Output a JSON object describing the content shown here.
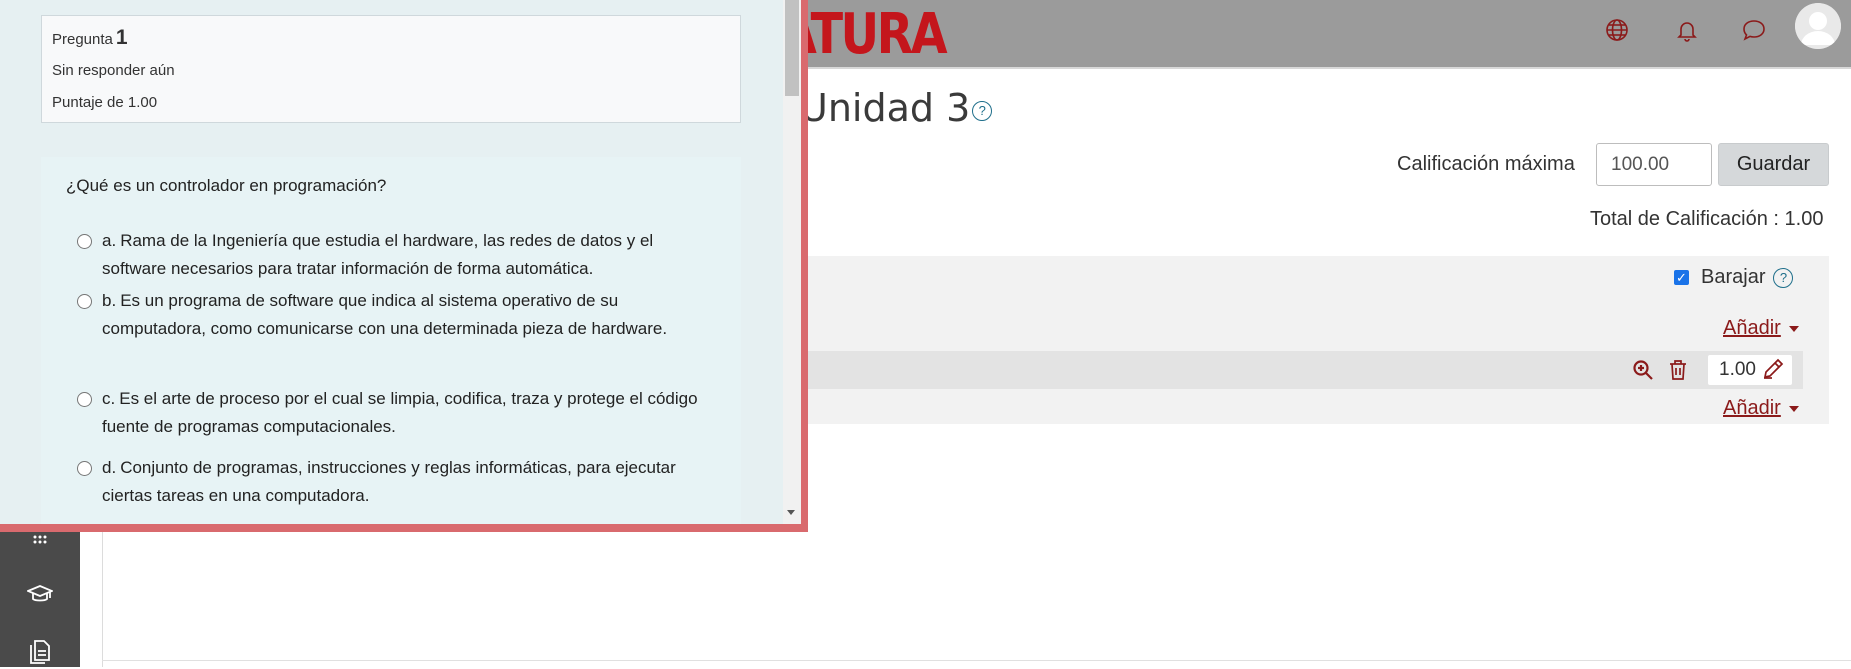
{
  "header": {
    "brand_fragment": "ATURA",
    "icons": [
      "globe-icon",
      "bell-icon",
      "chat-icon",
      "user-avatar"
    ]
  },
  "page": {
    "title": "Unidad 3",
    "help_glyph": "?"
  },
  "grading": {
    "max_label": "Calificación máxima",
    "max_value": "100.00",
    "save_label": "Guardar",
    "total_label": "Total de Calificación : 1.00"
  },
  "section": {
    "shuffle_label": "Barajar",
    "shuffle_checked": true,
    "add_label": "Añadir",
    "slot_mark": "1.00"
  },
  "preview": {
    "question_label": "Pregunta",
    "question_number": "1",
    "state": "Sin responder aún",
    "grade_text": "Puntaje de 1.00",
    "question_text": "¿Qué es un controlador en programación?",
    "answers": [
      {
        "letter": "a.",
        "text": "Rama de la Ingeniería que estudia el hardware, las redes de datos y el software necesarios para tratar información de forma automática."
      },
      {
        "letter": "b.",
        "text": "Es un programa de software que indica al sistema operativo de su computadora, como comunicarse con una determinada pieza de hardware."
      },
      {
        "letter": "c.",
        "text": "Es el arte de proceso por el cual se limpia, codifica, traza y protege el código fuente de programas computacionales."
      },
      {
        "letter": "d.",
        "text": "Conjunto de programas, instrucciones y reglas informáticas, para ejecutar ciertas tareas en una computadora."
      }
    ]
  },
  "colors": {
    "brand_red": "#c4161c",
    "link_red": "#8b1a1a",
    "popup_border": "#d96a6e",
    "popup_bg": "#e6f0f2",
    "topbar": "#9b9b9b",
    "nav_dark": "#4a4a4a"
  }
}
